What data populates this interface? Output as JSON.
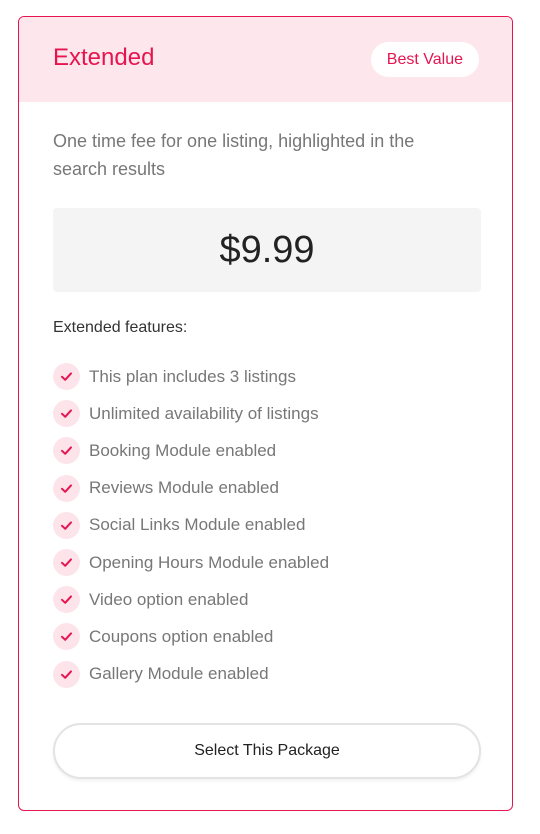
{
  "plan": {
    "title": "Extended",
    "badge": "Best Value",
    "description": "One time fee for one listing, highlighted in the search results",
    "price": "$9.99",
    "features_heading": "Extended features:",
    "features": [
      "This plan includes 3 listings",
      "Unlimited availability of listings",
      "Booking Module enabled",
      "Reviews Module enabled",
      "Social Links Module enabled",
      "Opening Hours Module enabled",
      "Video option enabled",
      "Coupons option enabled",
      "Gallery Module enabled"
    ],
    "button_label": "Select This Package"
  },
  "colors": {
    "accent": "#e6154f",
    "header_bg": "#fde7ec",
    "check_bg": "#fde4ea",
    "price_bg": "#f4f4f4"
  },
  "icons": {
    "feature_bullet": "check-icon"
  }
}
